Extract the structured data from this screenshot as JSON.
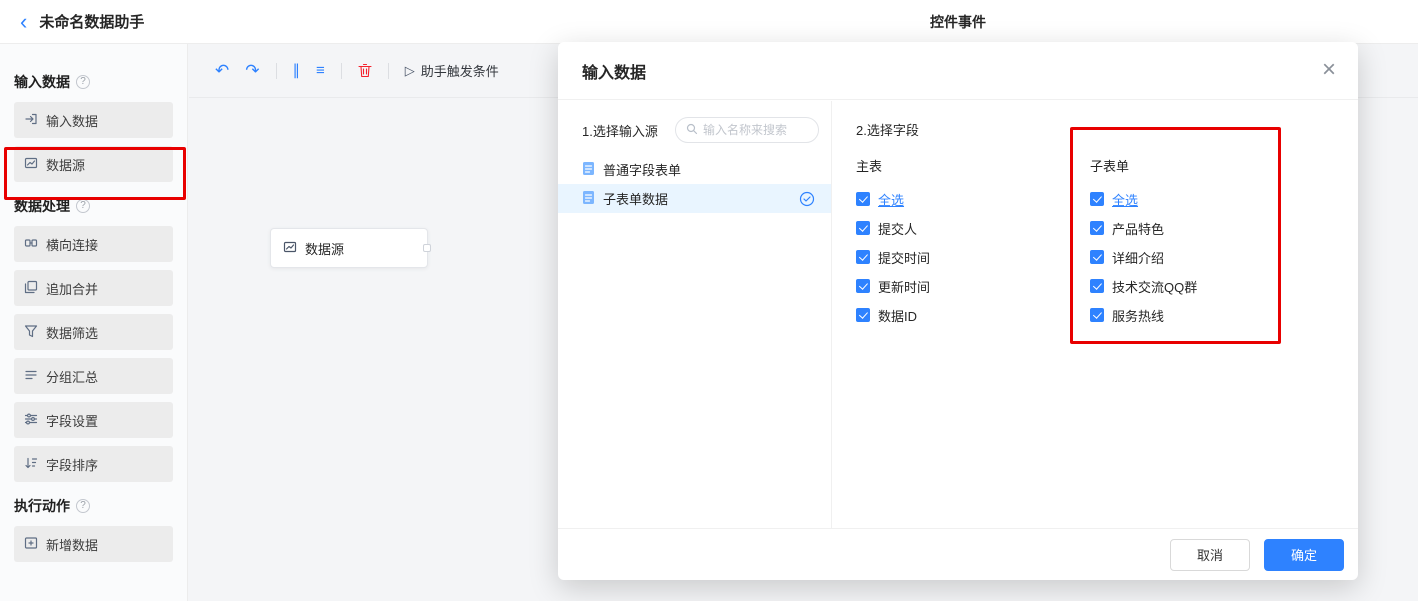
{
  "colors": {
    "accent": "#2e82ff",
    "annotation": "#e80000",
    "danger": "#f5222d",
    "selected_bg": "#e9f5ff"
  },
  "icons": {
    "back": "‹",
    "undo": "↶",
    "redo": "↷",
    "align_vertical": "∥",
    "align_horizontal": "≡",
    "play": "▷",
    "close": "×",
    "help": "?"
  },
  "topbar": {
    "title": "未命名数据助手",
    "tab": "控件事件"
  },
  "sidebar": {
    "sections": [
      {
        "title": "输入数据",
        "items": [
          {
            "label": "输入数据",
            "icon": "import-icon"
          },
          {
            "label": "数据源",
            "icon": "datasource-icon",
            "annotated": true
          }
        ]
      },
      {
        "title": "数据处理",
        "items": [
          {
            "label": "横向连接",
            "icon": "join-icon"
          },
          {
            "label": "追加合并",
            "icon": "merge-icon"
          },
          {
            "label": "数据筛选",
            "icon": "filter-icon"
          },
          {
            "label": "分组汇总",
            "icon": "group-icon"
          },
          {
            "label": "字段设置",
            "icon": "settings-icon"
          },
          {
            "label": "字段排序",
            "icon": "sort-icon"
          }
        ]
      },
      {
        "title": "执行动作",
        "items": [
          {
            "label": "新增数据",
            "icon": "add-icon"
          }
        ]
      }
    ]
  },
  "toolbar": {
    "trigger_label": "助手触发条件"
  },
  "canvas": {
    "node": {
      "label": "数据源"
    }
  },
  "modal": {
    "title": "输入数据",
    "source": {
      "label": "1.选择输入源",
      "search_placeholder": "输入名称来搜索",
      "items": [
        {
          "label": "普通字段表单",
          "selected": false
        },
        {
          "label": "子表单数据",
          "selected": true
        }
      ]
    },
    "fields": {
      "label": "2.选择字段",
      "groups": [
        {
          "title": "主表",
          "options": [
            "全选",
            "提交人",
            "提交时间",
            "更新时间",
            "数据ID"
          ],
          "all_checked": true
        },
        {
          "title": "子表单",
          "options": [
            "全选",
            "产品特色",
            "详细介绍",
            "技术交流QQ群",
            "服务热线"
          ],
          "all_checked": true,
          "annotated": true
        }
      ]
    },
    "footer": {
      "cancel": "取消",
      "confirm": "确定"
    }
  }
}
